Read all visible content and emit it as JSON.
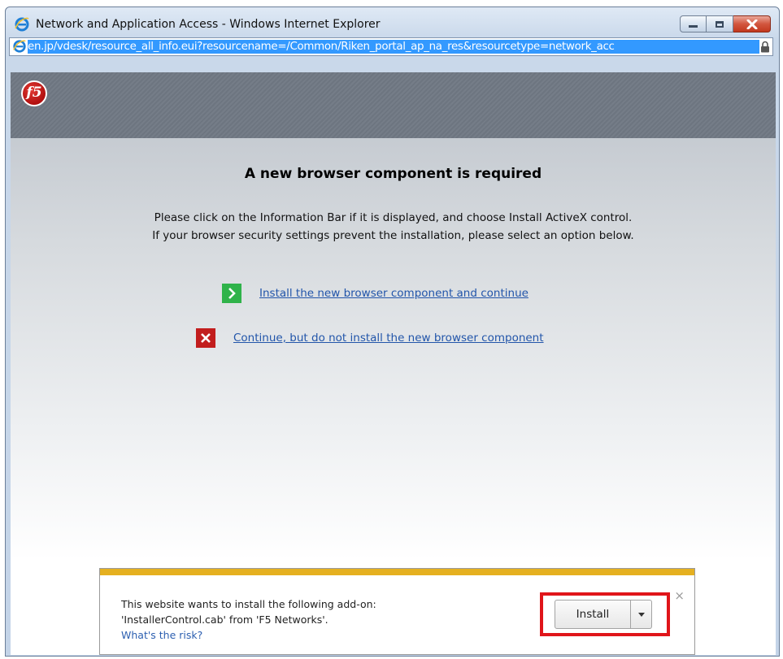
{
  "window": {
    "title": "Network and Application Access - Windows Internet Explorer"
  },
  "addressbar": {
    "url": "en.jp/vdesk/resource_all_info.eui?resourcename=/Common/Riken_portal_ap_na_res&resourcetype=network_acc"
  },
  "page": {
    "logo_text": "f5",
    "heading": "A new browser component is required",
    "instruction_line1": "Please click on the Information Bar if it is displayed, and choose Install ActiveX control.",
    "instruction_line2": "If your browser security settings prevent the installation, please select an option below.",
    "option_install": "Install the new browser component and continue",
    "option_no_install": "Continue, but do not install the new browser component"
  },
  "infobar": {
    "line1": "This website wants to install the following add-on:",
    "line2": "'InstallerControl.cab' from 'F5 Networks'.",
    "risk_link": "What's the risk?",
    "install_label": "Install",
    "close_glyph": "×"
  },
  "colors": {
    "accent_bar": "#e5b020",
    "highlight": "#e0151a",
    "link": "#2255aa",
    "install_icon": "#2fb34a",
    "cancel_icon": "#c21d1d"
  },
  "icons": [
    "ie-icon",
    "minimize-icon",
    "maximize-icon",
    "close-icon",
    "lock-icon",
    "f5-logo",
    "chevron-right-icon",
    "x-icon",
    "dropdown-caret-icon"
  ]
}
